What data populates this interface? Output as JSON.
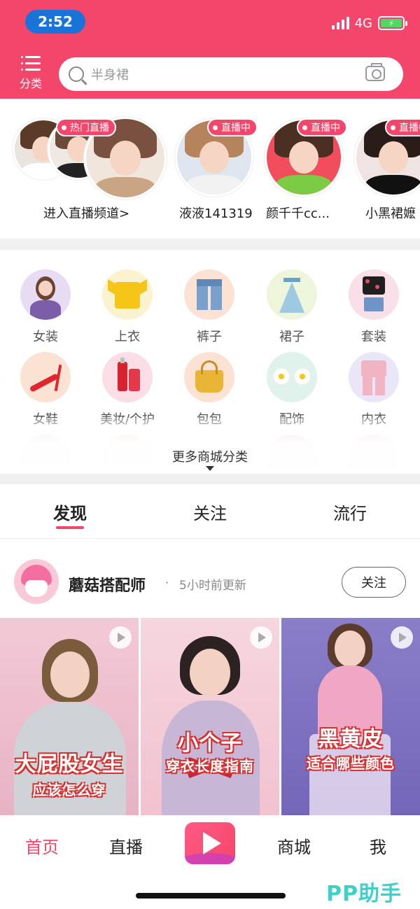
{
  "status_bar": {
    "time": "2:52",
    "network": "4G",
    "battery_color": "#4cd964"
  },
  "header": {
    "background": "#f4456a",
    "category_label": "分类",
    "category_icon": "list-icon",
    "search_placeholder": "半身裙",
    "camera_icon": "camera-icon"
  },
  "live": {
    "hot_badge": "热门直播",
    "channel_entry": "进入直播频道",
    "channel_chevron": ">",
    "streamers": [
      {
        "name": "液液141319",
        "badge": "直播中"
      },
      {
        "name": "颜千千cc...",
        "badge": "直播中"
      },
      {
        "name": "小黑裙嬷",
        "badge": "直播中"
      }
    ]
  },
  "categories": {
    "items": [
      {
        "label": "女装"
      },
      {
        "label": "上衣"
      },
      {
        "label": "裤子"
      },
      {
        "label": "裙子"
      },
      {
        "label": "套装"
      },
      {
        "label": "女鞋"
      },
      {
        "label": "美妆/个护"
      },
      {
        "label": "包包"
      },
      {
        "label": "配饰"
      },
      {
        "label": "内衣"
      }
    ],
    "more_label": "更多商城分类"
  },
  "tabs": {
    "items": [
      "发现",
      "关注",
      "流行"
    ],
    "active_index": 0
  },
  "feed": {
    "author": "蘑菇搭配师",
    "separator": "·",
    "updated": "5小时前更新",
    "follow_label": "关注",
    "videos": [
      {
        "title": "大屁股女生",
        "subtitle": "应该怎么穿"
      },
      {
        "title": "小个子",
        "subtitle": "穿衣长度指南"
      },
      {
        "title": "黑黄皮",
        "subtitle": "适合哪些颜色"
      }
    ]
  },
  "bottom_nav": {
    "items": [
      "首页",
      "直播",
      "商城",
      "我"
    ],
    "center_icon": "play-icon",
    "active_index": 0
  },
  "watermark": "PP助手"
}
